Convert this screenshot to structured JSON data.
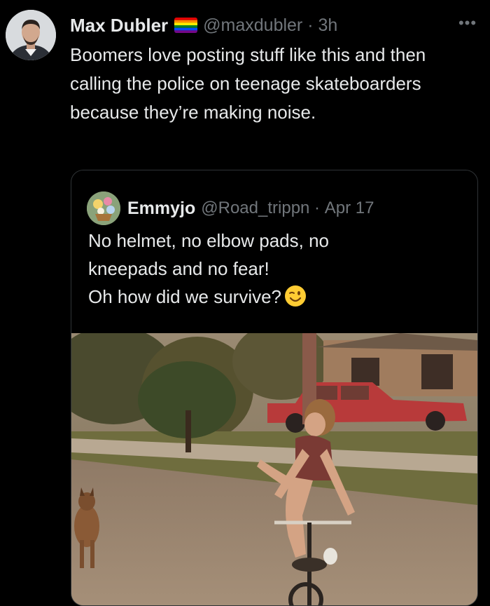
{
  "tweet": {
    "author": {
      "display_name": "Max Dubler",
      "handle": "@maxdubler",
      "time": "3h",
      "flag_icon": "rainbow-flag-icon"
    },
    "text": "Boomers love posting stuff like this and then calling the police on teenage skateboarders because they’re making noise.",
    "more_icon": "more-options-icon"
  },
  "quoted_tweet": {
    "author": {
      "display_name": "Emmyjo",
      "handle": "@Road_trippn",
      "date": "Apr 17"
    },
    "text_lines": [
      "No helmet, no elbow pads, no",
      "kneepads and no fear!",
      "Oh how did we survive?"
    ],
    "emoji": "winking-face-emoji"
  },
  "colors": {
    "background": "#000000",
    "text_primary": "#e7e9ea",
    "text_secondary": "#71767b",
    "border": "#2f3336"
  }
}
